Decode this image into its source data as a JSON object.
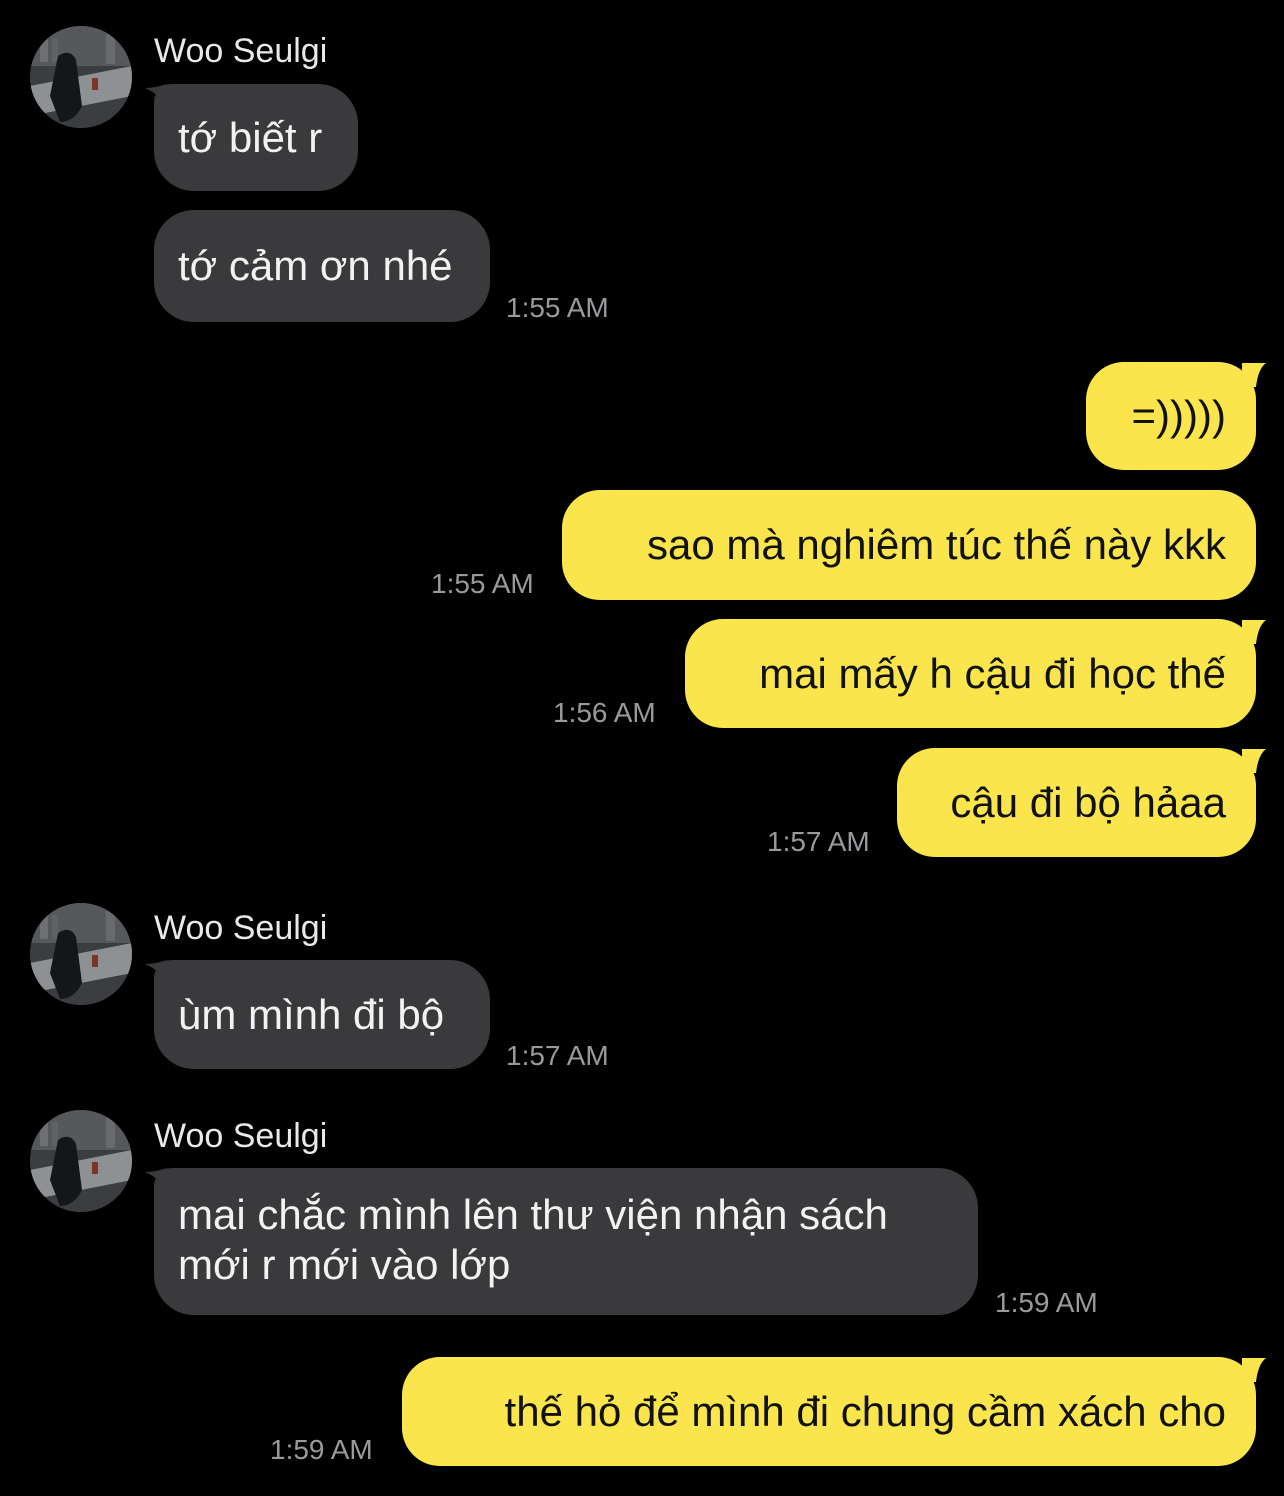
{
  "colors": {
    "background": "#000000",
    "incoming_bubble": "#3a3a3c",
    "outgoing_bubble": "#fae64c",
    "timestamp": "#9a9a9e"
  },
  "groups": [
    {
      "sender": "Woo Seulgi",
      "avatar_icon": "profile-photo",
      "messages": [
        "tớ biết r",
        "tớ cảm ơn nhé"
      ],
      "time": "1:55 AM"
    },
    {
      "sender": "Woo Seulgi",
      "avatar_icon": "profile-photo",
      "messages": [
        "ùm mình đi bộ"
      ],
      "time": "1:57 AM"
    },
    {
      "sender": "Woo Seulgi",
      "avatar_icon": "profile-photo",
      "messages": [
        "mai chắc mình lên thư viện nhận sách",
        "mới r mới vào lớp"
      ],
      "time": "1:59 AM"
    }
  ],
  "outgoing": [
    {
      "text": "=)))))",
      "time": ""
    },
    {
      "text": "sao mà nghiêm túc thế này kkk",
      "time": "1:55 AM"
    },
    {
      "text": "mai mấy h cậu đi học thế",
      "time": "1:56 AM"
    },
    {
      "text": "cậu đi bộ hảaa",
      "time": "1:57 AM"
    },
    {
      "text": "thế hỏ để mình đi chung cầm xách cho",
      "time": "1:59 AM"
    }
  ]
}
